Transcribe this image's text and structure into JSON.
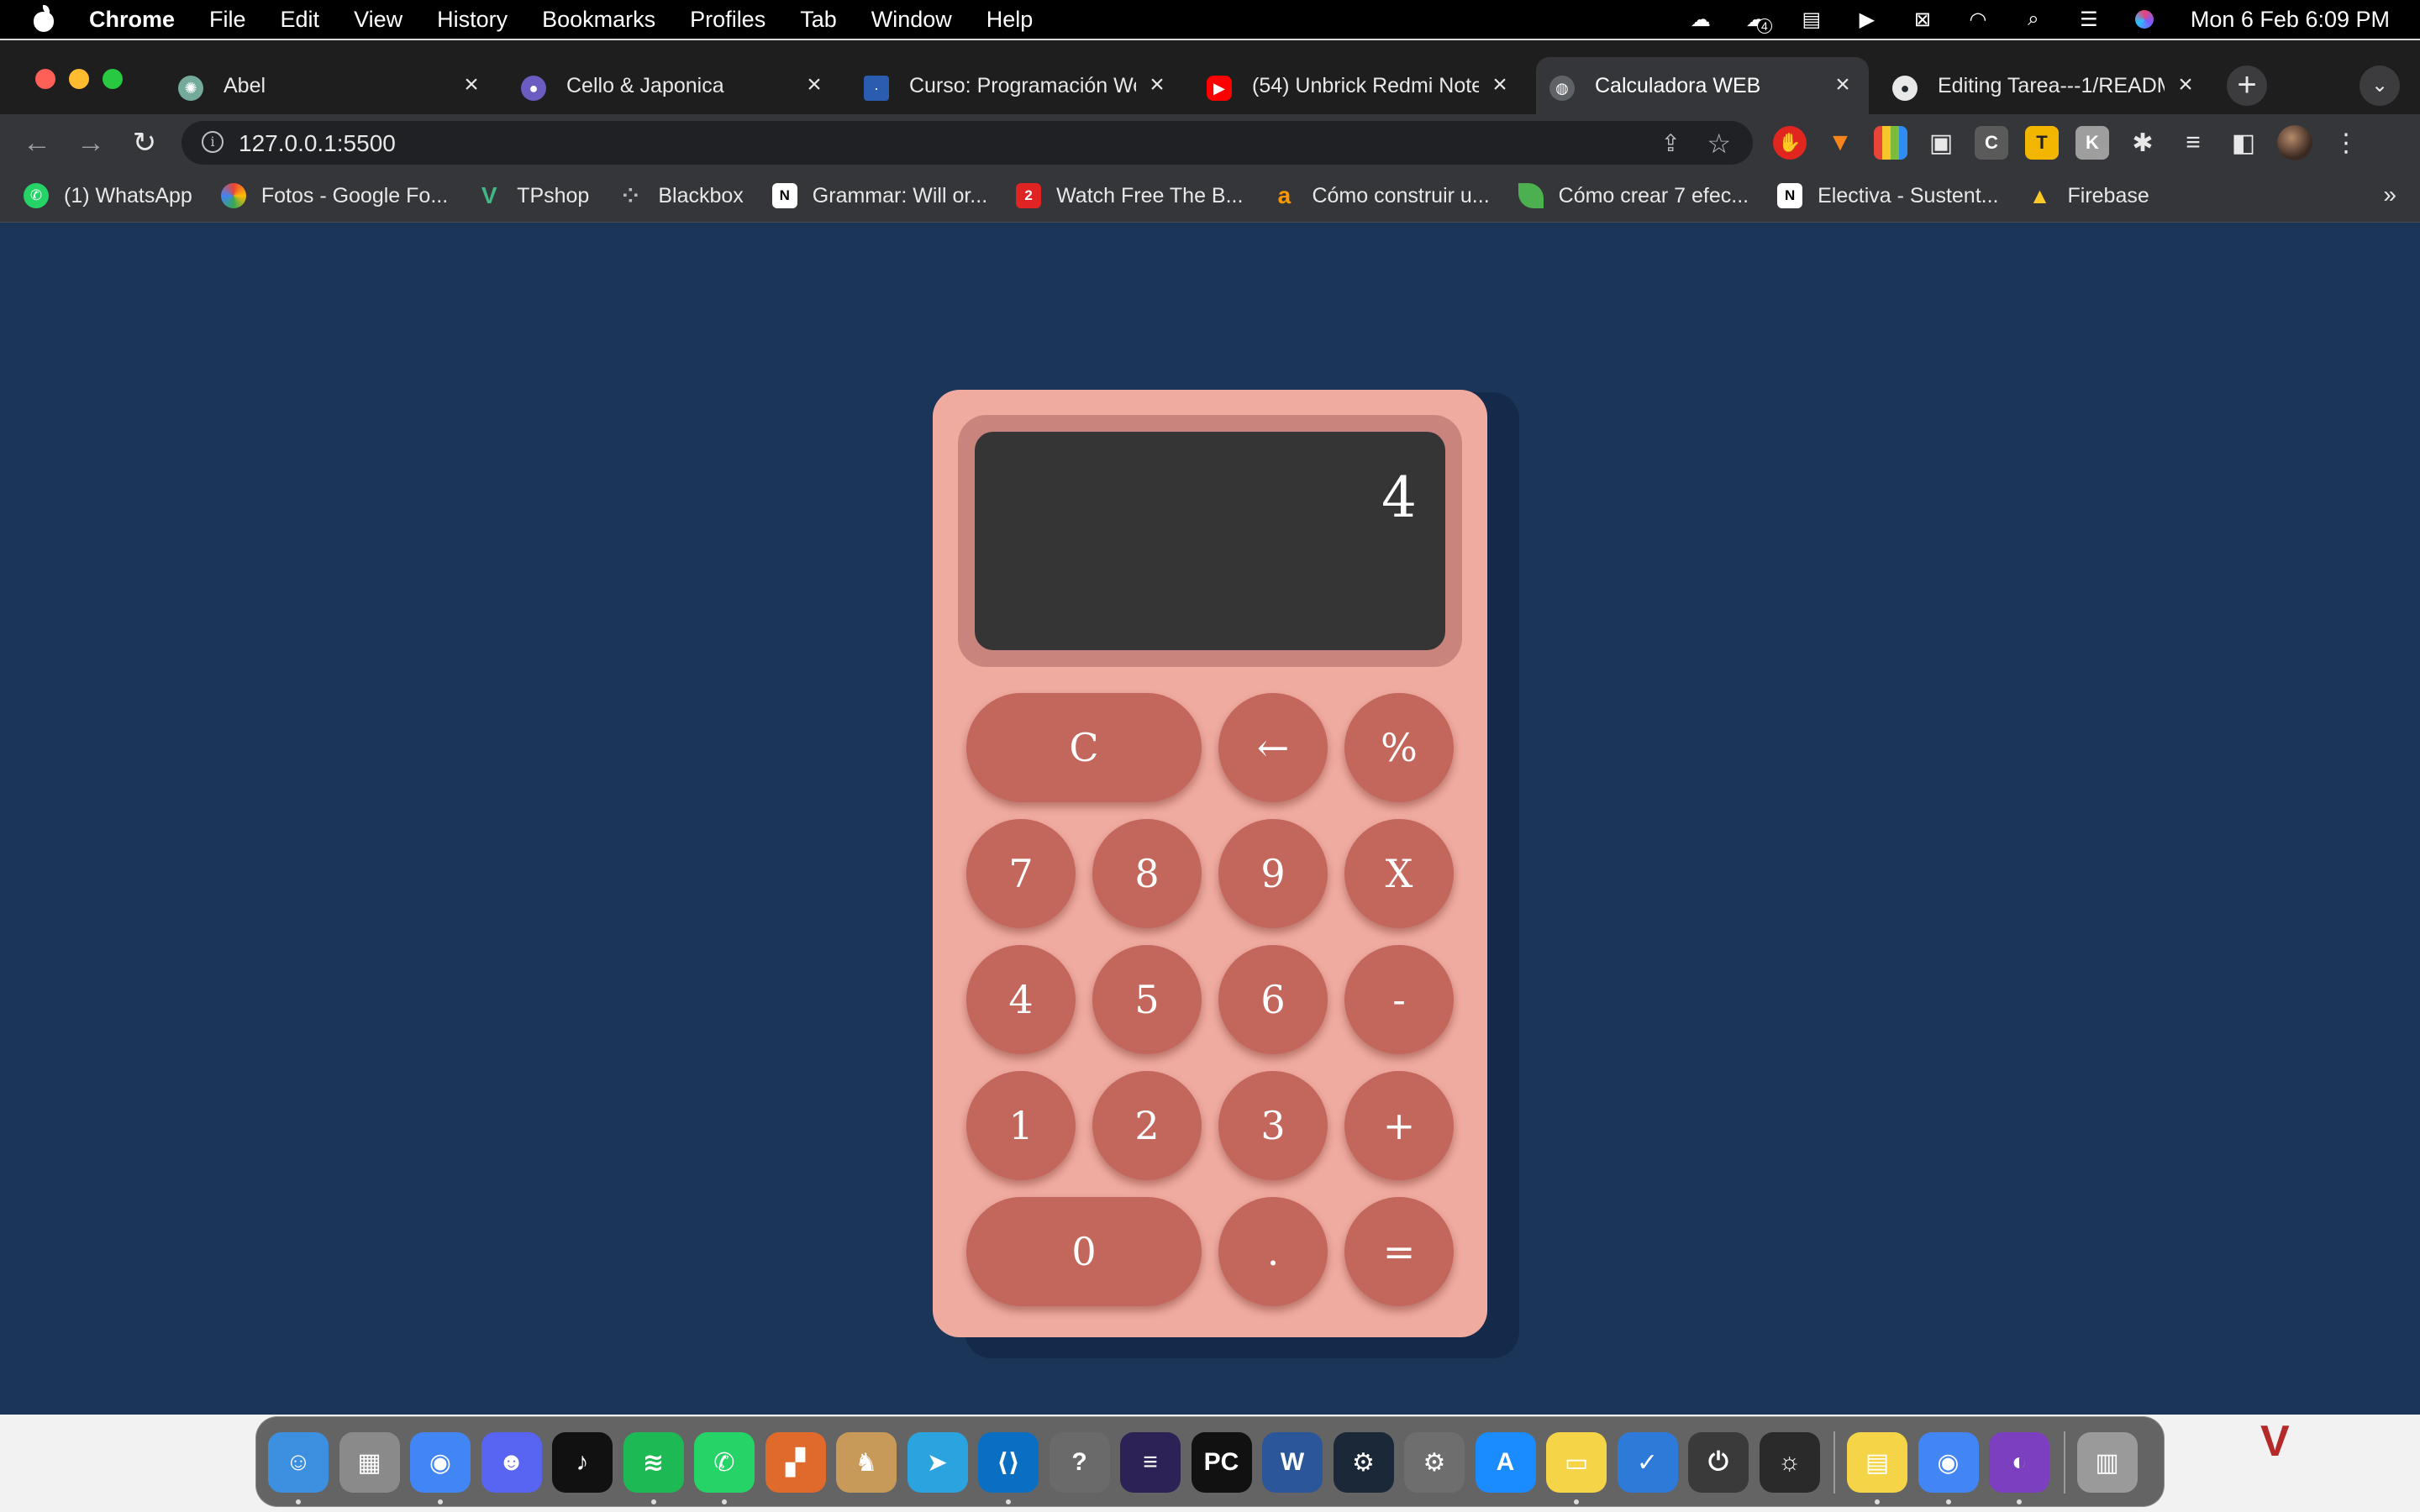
{
  "menubar": {
    "app_name": "Chrome",
    "items": [
      "File",
      "Edit",
      "View",
      "History",
      "Bookmarks",
      "Profiles",
      "Tab",
      "Window",
      "Help"
    ],
    "status_icons": [
      "cloud-icon",
      "cloud-sync-icon",
      "calendar-icon",
      "play-icon",
      "screen-record-icon",
      "wifi-icon",
      "search-icon",
      "control-center-icon",
      "siri-icon"
    ],
    "clock": "Mon 6 Feb  6:09 PM",
    "badge_count": "4"
  },
  "tabs": [
    {
      "title": "Abel",
      "icon": "chatgpt-icon",
      "color": "#74aa9c",
      "active": false
    },
    {
      "title": "Cello & Japonica",
      "icon": "drop-icon",
      "color": "#6b5cc2",
      "active": false
    },
    {
      "title": "Curso: Programación We",
      "icon": "course-icon",
      "color": "#2a5db0",
      "active": false
    },
    {
      "title": "(54) Unbrick Redmi Note",
      "icon": "youtube-icon",
      "color": "#ff0000",
      "active": false
    },
    {
      "title": "Calculadora WEB",
      "icon": "globe-icon",
      "color": "#5f6368",
      "active": true
    },
    {
      "title": "Editing Tarea---1/READM",
      "icon": "github-icon",
      "color": "#24292f",
      "active": false
    }
  ],
  "toolbar": {
    "url": "127.0.0.1:5500",
    "extensions": [
      {
        "name": "ublock-icon",
        "label": "✋",
        "color": "#e0261f"
      },
      {
        "name": "metamask-icon",
        "label": "🦊",
        "color": "#35363a"
      },
      {
        "name": "color-picker-icon",
        "label": "",
        "color": "#7bbd3a"
      },
      {
        "name": "picture-in-picture-icon",
        "label": "▣",
        "color": "#35363a"
      },
      {
        "name": "c-extension-icon",
        "label": "C",
        "color": "#5a5a5a"
      },
      {
        "name": "t-extension-icon",
        "label": "T",
        "color": "#f2b600"
      },
      {
        "name": "k-extension-icon",
        "label": "K",
        "color": "#9e9e9e"
      },
      {
        "name": "puzzle-icon",
        "label": "✱",
        "color": "#35363a"
      },
      {
        "name": "media-control-icon",
        "label": "≡",
        "color": "#35363a"
      },
      {
        "name": "side-panel-icon",
        "label": "◧",
        "color": "#35363a"
      }
    ]
  },
  "bookmarks": [
    {
      "label": "(1) WhatsApp",
      "icon": "whatsapp-icon",
      "color": "#25d366"
    },
    {
      "label": "Fotos - Google Fo...",
      "icon": "google-photos-icon",
      "color": "#ea4335"
    },
    {
      "label": "TPshop",
      "icon": "vue-icon",
      "color": "#41b883"
    },
    {
      "label": "Blackbox",
      "icon": "blackbox-icon",
      "color": "#555555"
    },
    {
      "label": "Grammar: Will or...",
      "icon": "notion-icon",
      "color": "#000000"
    },
    {
      "label": "Watch Free The B...",
      "icon": "stream-icon",
      "color": "#e02424"
    },
    {
      "label": "Cómo construir u...",
      "icon": "amazon-icon",
      "color": "#ff9900"
    },
    {
      "label": "Cómo crear 7 efec...",
      "icon": "leaf-icon",
      "color": "#4caf50"
    },
    {
      "label": "Electiva - Sustent...",
      "icon": "notion-icon",
      "color": "#000000"
    },
    {
      "label": "Firebase",
      "icon": "firebase-icon",
      "color": "#ffca28"
    }
  ],
  "calculator": {
    "display": "4",
    "buttons": [
      "C",
      "←",
      "%",
      "7",
      "8",
      "9",
      "X",
      "4",
      "5",
      "6",
      "-",
      "1",
      "2",
      "3",
      "+",
      "0",
      ".",
      "="
    ]
  },
  "dock": [
    {
      "name": "finder-icon",
      "color": "#3d8fe0",
      "running": true
    },
    {
      "name": "launchpad-icon",
      "color": "#8a8a8a",
      "running": false
    },
    {
      "name": "chrome-icon",
      "color": "#4285f4",
      "running": true
    },
    {
      "name": "discord-icon",
      "color": "#5865f2",
      "running": false
    },
    {
      "name": "tiktok-icon",
      "color": "#111111",
      "running": false
    },
    {
      "name": "spotify-icon",
      "color": "#1db954",
      "running": true
    },
    {
      "name": "whatsapp-icon",
      "color": "#25d366",
      "running": true
    },
    {
      "name": "collage-icon",
      "color": "#e06a2c",
      "running": false
    },
    {
      "name": "game-icon",
      "color": "#c89a5a",
      "running": false
    },
    {
      "name": "telegram-icon",
      "color": "#2aa3df",
      "running": false
    },
    {
      "name": "vscode-icon",
      "color": "#0a6fc2",
      "running": true
    },
    {
      "name": "help-icon",
      "color": "#6a6a6a",
      "running": false
    },
    {
      "name": "eclipse-icon",
      "color": "#2c2255",
      "running": false
    },
    {
      "name": "pycharm-icon",
      "color": "#111111",
      "running": false
    },
    {
      "name": "word-icon",
      "color": "#2b579a",
      "running": false
    },
    {
      "name": "steam-icon",
      "color": "#1b2838",
      "running": false
    },
    {
      "name": "system-settings-icon",
      "color": "#6e6e6e",
      "running": false
    },
    {
      "name": "app-store-icon",
      "color": "#1a8cff",
      "running": false
    },
    {
      "name": "notes-icon",
      "color": "#f5d547",
      "running": true
    },
    {
      "name": "tasks-icon",
      "color": "#2e7ad9",
      "running": false
    },
    {
      "name": "power-icon",
      "color": "#3a3a3a",
      "running": false
    },
    {
      "name": "brightness-icon",
      "color": "#2a2a2a",
      "running": false
    },
    {
      "name": "stickies-icon",
      "color": "#f5d547",
      "running": true
    },
    {
      "name": "chrome-icon",
      "color": "#4285f4",
      "running": true
    },
    {
      "name": "github-desktop-icon",
      "color": "#7b3fbf",
      "running": true
    },
    {
      "name": "trash-icon",
      "color": "#9a9a9a",
      "running": false
    }
  ]
}
